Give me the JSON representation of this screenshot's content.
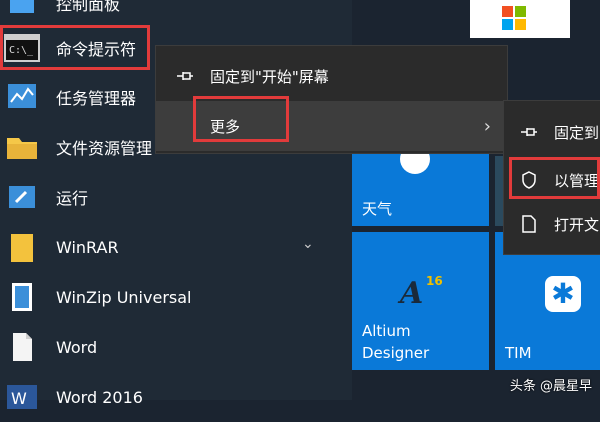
{
  "app_list": {
    "items": [
      {
        "label": "控制面板"
      },
      {
        "label": "命令提示符"
      },
      {
        "label": "任务管理器"
      },
      {
        "label": "文件资源管理"
      },
      {
        "label": "运行"
      },
      {
        "label": "WinRAR"
      },
      {
        "label": "WinZip Universal"
      },
      {
        "label": "Word"
      },
      {
        "label": "Word 2016"
      }
    ]
  },
  "context_menu_primary": {
    "pin_start": "固定到\"开始\"屏幕",
    "more": "更多"
  },
  "context_menu_secondary": {
    "pin_taskbar": "固定到",
    "run_as_admin": "以管理",
    "open_location": "打开文"
  },
  "tiles": {
    "weather": "天气",
    "altium_line1": "Altium",
    "altium_line2": "Designer",
    "tim": "TIM",
    "altium_badge": "16"
  },
  "watermark": "头条 @晨星早",
  "colors": {
    "tile_blue": "#0a79d8",
    "highlight_red": "#e23b3b",
    "menu_bg": "#2b2b2b"
  }
}
